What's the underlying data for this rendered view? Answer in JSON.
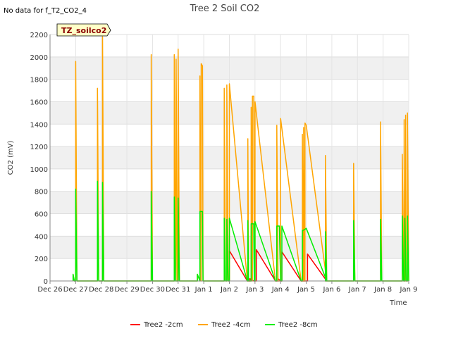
{
  "no_data_message": "No data for f_T2_CO2_4",
  "badge": "TZ_soilco2",
  "chart_data": {
    "type": "line",
    "title": "Tree 2 Soil CO2",
    "xlabel": "Time",
    "ylabel": "CO2 (mV)",
    "ylim": [
      0,
      2200
    ],
    "yticks": [
      0,
      200,
      400,
      600,
      800,
      1000,
      1200,
      1400,
      1600,
      1800,
      2000,
      2200
    ],
    "xlim": [
      0,
      14
    ],
    "x_unit": "days from Dec 26",
    "xtick_labels": [
      "Dec 26",
      "Dec 27",
      "Dec 28",
      "Dec 29",
      "Dec 30",
      "Dec 31",
      "Jan 1",
      "Jan 2",
      "Jan 3",
      "Jan 4",
      "Jan 5",
      "Jan 6",
      "Jan 7",
      "Jan 8",
      "Jan 9"
    ],
    "grid": true,
    "legend_position": "bottom",
    "series": [
      {
        "name": "Tree2 -2cm",
        "color": "#ff0000",
        "points": [
          [
            7.0,
            0
          ],
          [
            7.0,
            270
          ],
          [
            7.7,
            0
          ],
          [
            7.8,
            0
          ],
          [
            7.8,
            20
          ],
          [
            7.95,
            0
          ],
          [
            8.05,
            0
          ],
          [
            8.05,
            280
          ],
          [
            8.8,
            0
          ],
          [
            8.9,
            0
          ],
          [
            8.9,
            20
          ],
          [
            9.0,
            0
          ],
          [
            9.05,
            0
          ],
          [
            9.05,
            260
          ],
          [
            9.8,
            0
          ],
          [
            9.9,
            0
          ],
          [
            10.05,
            0
          ],
          [
            10.05,
            240
          ],
          [
            10.8,
            0
          ]
        ]
      },
      {
        "name": "Tree2 -4cm",
        "color": "#ffa500",
        "points": [
          [
            0.9,
            0
          ],
          [
            0.9,
            60
          ],
          [
            0.95,
            0
          ],
          [
            1.0,
            0
          ],
          [
            1.0,
            1960
          ],
          [
            1.05,
            0
          ],
          [
            1.85,
            0
          ],
          [
            1.85,
            1720
          ],
          [
            1.9,
            0
          ],
          [
            2.05,
            0
          ],
          [
            2.05,
            2180
          ],
          [
            2.1,
            0
          ],
          [
            3.95,
            0
          ],
          [
            3.95,
            2020
          ],
          [
            4.0,
            0
          ],
          [
            4.85,
            0
          ],
          [
            4.85,
            2020
          ],
          [
            4.9,
            0
          ],
          [
            4.92,
            0
          ],
          [
            4.92,
            1980
          ],
          [
            4.97,
            0
          ],
          [
            5.0,
            0
          ],
          [
            5.0,
            2070
          ],
          [
            5.05,
            0
          ],
          [
            5.75,
            0
          ],
          [
            5.75,
            60
          ],
          [
            5.85,
            0
          ],
          [
            5.85,
            1830
          ],
          [
            5.88,
            0
          ],
          [
            5.9,
            0
          ],
          [
            5.9,
            1940
          ],
          [
            5.95,
            1920
          ],
          [
            5.97,
            0
          ],
          [
            6.8,
            0
          ],
          [
            6.8,
            1720
          ],
          [
            6.85,
            0
          ],
          [
            6.9,
            0
          ],
          [
            6.9,
            1750
          ],
          [
            6.95,
            0
          ],
          [
            7.0,
            0
          ],
          [
            7.0,
            1760
          ],
          [
            7.7,
            0
          ],
          [
            7.72,
            0
          ],
          [
            7.72,
            1270
          ],
          [
            7.75,
            0
          ],
          [
            7.85,
            0
          ],
          [
            7.85,
            1550
          ],
          [
            7.88,
            0
          ],
          [
            7.9,
            0
          ],
          [
            7.9,
            1650
          ],
          [
            7.95,
            1650
          ],
          [
            7.97,
            0
          ],
          [
            8.0,
            0
          ],
          [
            8.0,
            1600
          ],
          [
            8.8,
            0
          ],
          [
            8.85,
            0
          ],
          [
            8.85,
            1390
          ],
          [
            8.9,
            0
          ],
          [
            9.0,
            0
          ],
          [
            9.0,
            1450
          ],
          [
            9.8,
            0
          ],
          [
            9.85,
            0
          ],
          [
            9.85,
            1310
          ],
          [
            9.88,
            0
          ],
          [
            9.9,
            0
          ],
          [
            9.9,
            1370
          ],
          [
            9.93,
            0
          ],
          [
            9.95,
            0
          ],
          [
            9.95,
            1410
          ],
          [
            10.0,
            1390
          ],
          [
            10.8,
            0
          ],
          [
            10.75,
            0
          ],
          [
            10.75,
            1120
          ],
          [
            10.8,
            0
          ],
          [
            11.85,
            0
          ],
          [
            11.85,
            1050
          ],
          [
            11.9,
            0
          ],
          [
            12.9,
            0
          ],
          [
            12.9,
            1420
          ],
          [
            12.95,
            0
          ],
          [
            13.75,
            0
          ],
          [
            13.75,
            1130
          ],
          [
            13.8,
            0
          ],
          [
            13.82,
            0
          ],
          [
            13.82,
            1440
          ],
          [
            13.85,
            0
          ],
          [
            13.88,
            0
          ],
          [
            13.88,
            1480
          ],
          [
            13.9,
            0
          ],
          [
            13.95,
            0
          ],
          [
            13.95,
            1500
          ],
          [
            14.0,
            0
          ]
        ]
      },
      {
        "name": "Tree2 -8cm",
        "color": "#00ee00",
        "points": [
          [
            0.9,
            0
          ],
          [
            0.9,
            60
          ],
          [
            0.95,
            0
          ],
          [
            1.0,
            0
          ],
          [
            1.0,
            820
          ],
          [
            1.05,
            0
          ],
          [
            1.85,
            0
          ],
          [
            1.85,
            890
          ],
          [
            1.9,
            0
          ],
          [
            2.05,
            0
          ],
          [
            2.05,
            880
          ],
          [
            2.1,
            0
          ],
          [
            3.95,
            0
          ],
          [
            3.95,
            800
          ],
          [
            4.0,
            0
          ],
          [
            4.85,
            0
          ],
          [
            4.85,
            750
          ],
          [
            4.9,
            0
          ],
          [
            5.0,
            0
          ],
          [
            5.0,
            740
          ],
          [
            5.05,
            0
          ],
          [
            5.75,
            0
          ],
          [
            5.75,
            60
          ],
          [
            5.85,
            0
          ],
          [
            5.85,
            620
          ],
          [
            5.95,
            620
          ],
          [
            5.97,
            0
          ],
          [
            6.8,
            0
          ],
          [
            6.8,
            560
          ],
          [
            6.85,
            0
          ],
          [
            6.9,
            0
          ],
          [
            6.9,
            550
          ],
          [
            6.95,
            0
          ],
          [
            7.0,
            0
          ],
          [
            7.0,
            560
          ],
          [
            7.7,
            0
          ],
          [
            7.72,
            0
          ],
          [
            7.72,
            540
          ],
          [
            7.75,
            0
          ],
          [
            7.85,
            0
          ],
          [
            7.85,
            510
          ],
          [
            7.95,
            510
          ],
          [
            7.97,
            0
          ],
          [
            8.0,
            0
          ],
          [
            8.0,
            530
          ],
          [
            8.8,
            0
          ],
          [
            8.85,
            0
          ],
          [
            8.85,
            490
          ],
          [
            8.95,
            490
          ],
          [
            9.0,
            0
          ],
          [
            9.05,
            0
          ],
          [
            9.05,
            490
          ],
          [
            9.8,
            0
          ],
          [
            9.85,
            0
          ],
          [
            9.85,
            450
          ],
          [
            9.95,
            460
          ],
          [
            10.0,
            470
          ],
          [
            10.8,
            0
          ],
          [
            10.75,
            0
          ],
          [
            10.75,
            440
          ],
          [
            10.8,
            0
          ],
          [
            11.85,
            0
          ],
          [
            11.85,
            540
          ],
          [
            11.9,
            0
          ],
          [
            12.9,
            0
          ],
          [
            12.9,
            550
          ],
          [
            12.95,
            0
          ],
          [
            13.75,
            0
          ],
          [
            13.75,
            580
          ],
          [
            13.8,
            0
          ],
          [
            13.85,
            0
          ],
          [
            13.85,
            560
          ],
          [
            13.9,
            0
          ],
          [
            13.95,
            0
          ],
          [
            13.95,
            580
          ],
          [
            14.0,
            0
          ]
        ]
      }
    ]
  }
}
